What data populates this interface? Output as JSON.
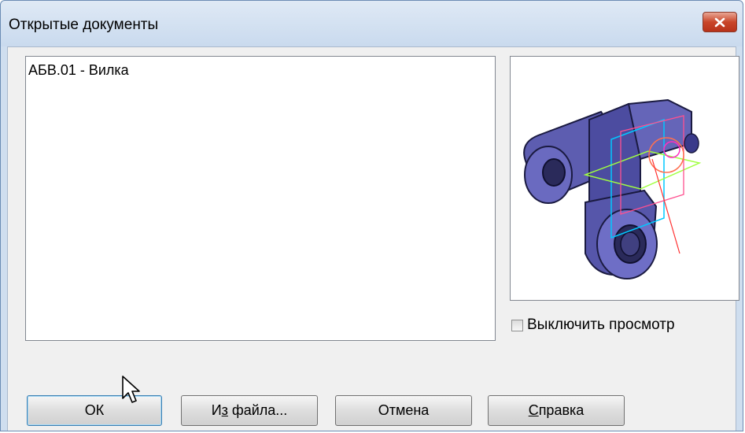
{
  "window": {
    "title": "Открытые документы"
  },
  "documents": [
    {
      "label": "АБВ.01 - Вилка"
    }
  ],
  "preview": {
    "disable_label": "Выключить просмотр",
    "disable_checked": false
  },
  "buttons": {
    "ok": {
      "label": "ОК"
    },
    "from_file": {
      "mnemonic": "з",
      "pre": "И",
      "post": " файла..."
    },
    "cancel": {
      "label": "Отмена"
    },
    "help": {
      "mnemonic": "С",
      "pre": "",
      "post": "правка"
    }
  },
  "icons": {
    "close": "close-icon",
    "cursor": "mouse-pointer-icon",
    "model": "3d-part-preview"
  },
  "colors": {
    "close_button": "#c9462a",
    "model_fill": "#5a5aa8",
    "titlebar": "#dfe9f5"
  }
}
